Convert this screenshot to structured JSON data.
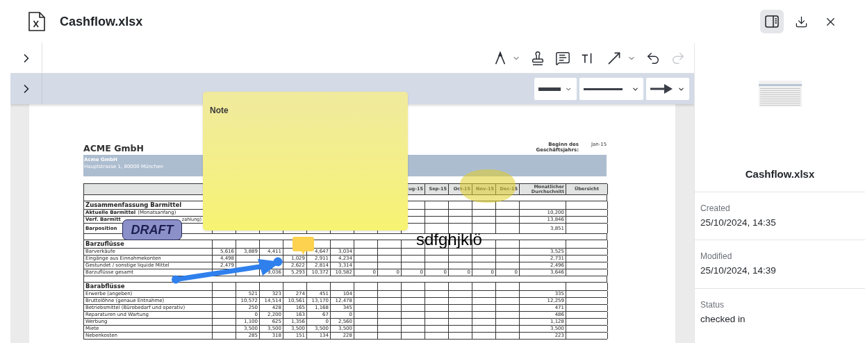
{
  "window": {
    "title": "Cashflow.xlsx",
    "panel_toggle": {
      "selected": true
    }
  },
  "toolbar": {
    "tools": [
      {
        "kind": "pen",
        "caret": true,
        "disabled": false
      },
      {
        "kind": "stamp",
        "caret": false,
        "disabled": false
      },
      {
        "kind": "comment",
        "caret": false,
        "disabled": false
      },
      {
        "kind": "text",
        "caret": false,
        "disabled": false
      },
      {
        "kind": "arrow",
        "caret": true,
        "disabled": false
      },
      {
        "kind": "undo",
        "caret": false,
        "disabled": false
      },
      {
        "kind": "redo",
        "caret": false,
        "disabled": true
      }
    ],
    "style_pickers": [
      {
        "kind": "thickness"
      },
      {
        "kind": "line"
      },
      {
        "kind": "arrowhead"
      }
    ]
  },
  "document": {
    "company": "ACME GmbH",
    "fiscal_start_label": "Beginn des Geschäftsjahrs:",
    "fiscal_start": "Jan-15",
    "band_name": "Acme GmbH",
    "band_address": "Hauptstrasse 1, 80000 München",
    "table": {
      "header": [
        {
          "kind": "empty"
        },
        {
          "kind": "empty"
        },
        {
          "kind": "empty"
        },
        {
          "kind": "empty"
        },
        {
          "kind": "empty"
        },
        {
          "kind": "empty"
        },
        {
          "kind": "empty"
        },
        {
          "kind": "empty"
        },
        {
          "kind": "value",
          "text": "ug-15"
        },
        {
          "kind": "value",
          "text": "Sep-15"
        },
        {
          "kind": "value",
          "text": "Oct-15"
        },
        {
          "kind": "value",
          "text": "Nov-15"
        },
        {
          "kind": "value",
          "text": "Dec-15"
        }
      ],
      "header_average": "Monatlicher Durchschnitt",
      "header_overview": "Übersicht",
      "rows": [
        {
          "kind": "blank"
        },
        {
          "kind": "section",
          "label": "Zusammenfassung Barmittel"
        },
        {
          "kind": "line",
          "bold": true,
          "label": "Aktuelle Barmittel",
          "suffix": "(Monatsanfang)",
          "average": "10,200"
        },
        {
          "kind": "line",
          "bold": true,
          "label": "Verf. Barmitt",
          "tail": "zahlung)",
          "average": "13,846"
        },
        {
          "kind": "line",
          "bold": true,
          "tall": true,
          "label": "Barposition",
          "average": "3,851"
        },
        {
          "kind": "blank"
        },
        {
          "kind": "section",
          "label": "Barzuflüsse"
        },
        {
          "kind": "line",
          "bold": false,
          "label": "Barverkäufe",
          "values": [
            {
              "kind": "value",
              "text": "5,616"
            },
            {
              "kind": "value",
              "text": "3,889"
            },
            {
              "kind": "value",
              "text": "4,411"
            },
            {
              "kind": "empty"
            },
            {
              "kind": "value",
              "text": "4,647"
            },
            {
              "kind": "value",
              "text": "3,034"
            }
          ],
          "average": "3,525"
        },
        {
          "kind": "line",
          "bold": false,
          "label": "Eingänge aus Einnahmekonten",
          "values": [
            {
              "kind": "value",
              "text": "4,498"
            },
            {
              "kind": "empty"
            },
            {
              "kind": "empty"
            },
            {
              "kind": "value",
              "text": "1,029"
            },
            {
              "kind": "value",
              "text": "2,911"
            },
            {
              "kind": "value",
              "text": "4,234"
            }
          ],
          "average": "2,731"
        },
        {
          "kind": "line",
          "bold": false,
          "label": "Gestundet / sonstige liquide Mittel",
          "values": [
            {
              "kind": "value",
              "text": "2,479"
            },
            {
              "kind": "empty"
            },
            {
              "kind": "empty"
            },
            {
              "kind": "value",
              "text": "2,622"
            },
            {
              "kind": "value",
              "text": "2,814"
            },
            {
              "kind": "value",
              "text": "3,314"
            }
          ],
          "average": "2,496"
        },
        {
          "kind": "line",
          "bold": false,
          "label": "Barzuflüsse gesamt",
          "values": [
            {
              "kind": "empty"
            },
            {
              "kind": "empty"
            },
            {
              "kind": "value",
              "text": "9,036"
            },
            {
              "kind": "value",
              "text": "5,293"
            },
            {
              "kind": "value",
              "text": "10,372"
            },
            {
              "kind": "value",
              "text": "10,582"
            },
            {
              "kind": "value",
              "text": "0"
            },
            {
              "kind": "value",
              "text": "0"
            },
            {
              "kind": "value",
              "text": "0"
            },
            {
              "kind": "value",
              "text": "0"
            },
            {
              "kind": "value",
              "text": "0"
            },
            {
              "kind": "value",
              "text": "0"
            },
            {
              "kind": "value",
              "text": "0"
            }
          ],
          "average": "3,646"
        },
        {
          "kind": "blank"
        },
        {
          "kind": "section",
          "label": "Barabflüsse"
        },
        {
          "kind": "line",
          "bold": false,
          "label": "Erwerbe (angeben)",
          "values": [
            {
              "kind": "empty"
            },
            {
              "kind": "value",
              "text": "521"
            },
            {
              "kind": "value",
              "text": "323"
            },
            {
              "kind": "value",
              "text": "274"
            },
            {
              "kind": "value",
              "text": "451"
            },
            {
              "kind": "value",
              "text": "104"
            }
          ],
          "average": "335"
        },
        {
          "kind": "line",
          "bold": false,
          "label": "Bruttolöhne (genaue Entnahme)",
          "values": [
            {
              "kind": "empty"
            },
            {
              "kind": "value",
              "text": "10,572"
            },
            {
              "kind": "value",
              "text": "14,514"
            },
            {
              "kind": "value",
              "text": "10,561"
            },
            {
              "kind": "value",
              "text": "13,170"
            },
            {
              "kind": "value",
              "text": "12,478"
            }
          ],
          "average": "12,259"
        },
        {
          "kind": "line",
          "bold": false,
          "label": "Betriebsmittel (Bürobedarf und operativ)",
          "values": [
            {
              "kind": "empty"
            },
            {
              "kind": "value",
              "text": "250"
            },
            {
              "kind": "value",
              "text": "428"
            },
            {
              "kind": "value",
              "text": "165"
            },
            {
              "kind": "value",
              "text": "1,168"
            },
            {
              "kind": "value",
              "text": "345"
            }
          ],
          "average": "471"
        },
        {
          "kind": "line",
          "bold": false,
          "label": "Reparaturen und Wartung",
          "values": [
            {
              "kind": "empty"
            },
            {
              "kind": "value",
              "text": "0"
            },
            {
              "kind": "value",
              "text": "2,200"
            },
            {
              "kind": "value",
              "text": "163"
            },
            {
              "kind": "value",
              "text": "67"
            },
            {
              "kind": "value",
              "text": "0"
            }
          ],
          "average": "486"
        },
        {
          "kind": "line",
          "bold": false,
          "label": "Werbung",
          "values": [
            {
              "kind": "empty"
            },
            {
              "kind": "value",
              "text": "1,100"
            },
            {
              "kind": "value",
              "text": "625"
            },
            {
              "kind": "value",
              "text": "1,356"
            },
            {
              "kind": "value",
              "text": "0"
            },
            {
              "kind": "value",
              "text": "2,560"
            }
          ],
          "average": "1,128"
        },
        {
          "kind": "line",
          "bold": false,
          "label": "Miete",
          "values": [
            {
              "kind": "empty"
            },
            {
              "kind": "value",
              "text": "3,500"
            },
            {
              "kind": "value",
              "text": "3,500"
            },
            {
              "kind": "value",
              "text": "3,500"
            },
            {
              "kind": "value",
              "text": "3,500"
            },
            {
              "kind": "value",
              "text": "3,500"
            }
          ],
          "average": "3,500"
        },
        {
          "kind": "line",
          "bold": false,
          "label": "Nebenkosten",
          "values": [
            {
              "kind": "empty"
            },
            {
              "kind": "value",
              "text": "285"
            },
            {
              "kind": "value",
              "text": "318"
            },
            {
              "kind": "value",
              "text": "151"
            },
            {
              "kind": "value",
              "text": "134"
            },
            {
              "kind": "value",
              "text": "228"
            }
          ],
          "average": "223"
        }
      ]
    }
  },
  "annotations": {
    "note": {
      "title": "Note"
    },
    "stamp": {
      "text": "DRAFT"
    },
    "free_text": "sdfghjklö"
  },
  "details": {
    "title": "Cashflow.xlsx",
    "fields": [
      {
        "label": "Created",
        "value": "25/10/2024, 14:35"
      },
      {
        "label": "Modified",
        "value": "25/10/2024, 14:39"
      },
      {
        "label": "Status",
        "value": "checked in"
      }
    ]
  }
}
